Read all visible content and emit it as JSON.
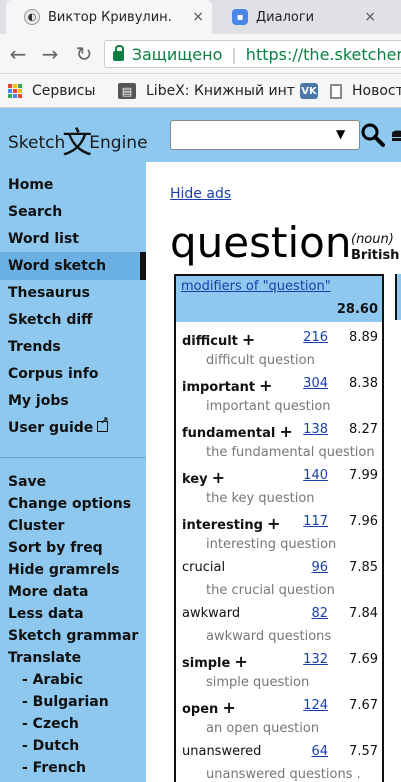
{
  "browser": {
    "tabs": [
      {
        "title": "Виктор Кривулин.",
        "active": true,
        "icon": "moon-favicon"
      },
      {
        "title": "Диалоги",
        "active": false,
        "icon": "chat-favicon"
      }
    ],
    "close_glyph": "×",
    "secure_label": "Защищено",
    "url": "https://the.sketcher",
    "bookmarks": [
      {
        "label": "Сервисы",
        "icon": "apps-grid-icon"
      },
      {
        "label": "LibeX: Книжный инт",
        "icon": "books-icon"
      },
      {
        "label": "",
        "icon": "vk-icon"
      },
      {
        "label": "Новости",
        "icon": "document-icon"
      }
    ],
    "vk_glyph": "VK"
  },
  "header": {
    "logo_left": "Sketch",
    "logo_char": "文",
    "logo_right": "Engine",
    "search_caret": "▼"
  },
  "sidebar": {
    "primary": [
      "Home",
      "Search",
      "Word list",
      "Word sketch",
      "Thesaurus",
      "Sketch diff",
      "Trends",
      "Corpus info",
      "My jobs",
      "User guide"
    ],
    "active": "Word sketch",
    "secondary": [
      "Save",
      "Change options",
      "Cluster",
      "Sort by freq",
      "Hide gramrels",
      "More data",
      "Less data",
      "Sketch grammar",
      "Translate"
    ],
    "languages": [
      "- Arabic",
      "- Bulgarian",
      "- Czech",
      "- Dutch",
      "- French"
    ]
  },
  "main": {
    "hide_ads": "Hide ads",
    "headword": "question",
    "pos": "(noun)",
    "corpus": "British",
    "table": {
      "title": "modifiers of \"question\"",
      "score": "28.60",
      "rows": [
        {
          "word": "difficult",
          "plus": true,
          "freq": "216",
          "score": "8.89",
          "example": "difficult question"
        },
        {
          "word": "important",
          "plus": true,
          "freq": "304",
          "score": "8.38",
          "example": "important question"
        },
        {
          "word": "fundamental",
          "plus": true,
          "freq": "138",
          "score": "8.27",
          "example": "the fundamental question"
        },
        {
          "word": "key",
          "plus": true,
          "freq": "140",
          "score": "7.99",
          "example": "the key question"
        },
        {
          "word": "interesting",
          "plus": true,
          "freq": "117",
          "score": "7.96",
          "example": "interesting question"
        },
        {
          "word": "crucial",
          "plus": false,
          "freq": "96",
          "score": "7.85",
          "example": "the crucial question"
        },
        {
          "word": "awkward",
          "plus": false,
          "freq": "82",
          "score": "7.84",
          "example": "awkward questions"
        },
        {
          "word": "simple",
          "plus": true,
          "freq": "132",
          "score": "7.69",
          "example": "simple question"
        },
        {
          "word": "open",
          "plus": true,
          "freq": "124",
          "score": "7.67",
          "example": "an open question"
        },
        {
          "word": "unanswered",
          "plus": false,
          "freq": "64",
          "score": "7.57",
          "example": "unanswered questions ."
        }
      ]
    }
  }
}
